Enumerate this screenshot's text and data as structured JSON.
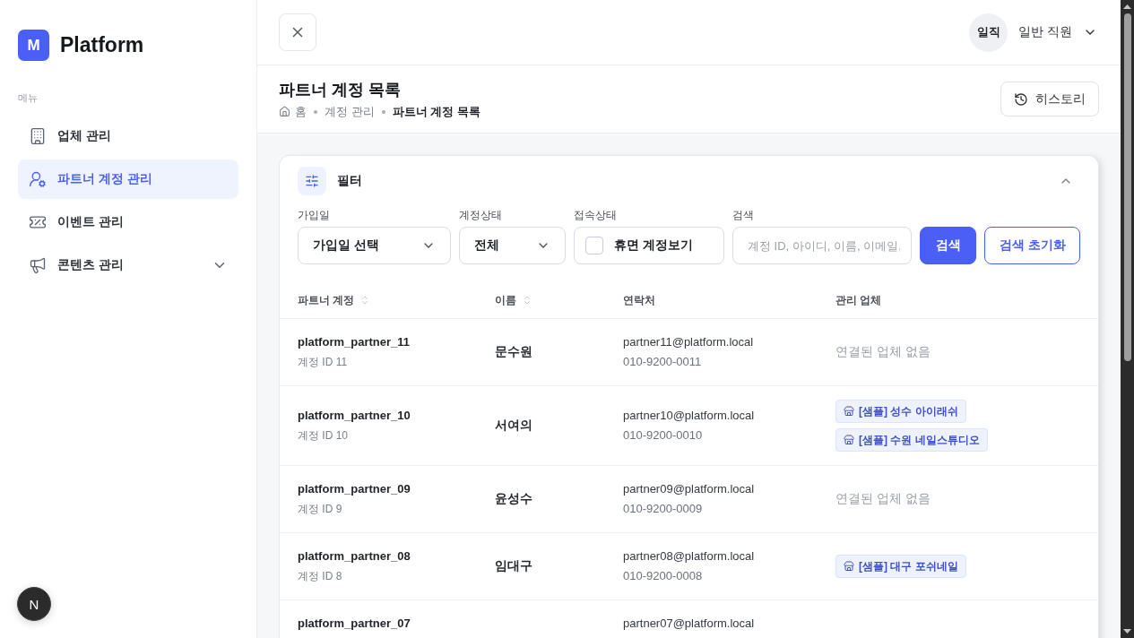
{
  "sidebar": {
    "logo": {
      "letter": "M",
      "name": "Platform"
    },
    "section_label": "메뉴",
    "items": [
      {
        "label": "업체 관리",
        "selected": false
      },
      {
        "label": "파트너 계정 관리",
        "selected": true
      },
      {
        "label": "이벤트 관리",
        "selected": false
      },
      {
        "label": "콘텐츠 관리",
        "selected": false,
        "expanded": false
      }
    ]
  },
  "dev_indicator": {
    "label": "N"
  },
  "topbar": {
    "user": {
      "avatar": "일직",
      "name": "일반 직원"
    }
  },
  "page_header": {
    "title": "파트너 계정 목록",
    "breadcrumb": [
      {
        "label": "홈",
        "current": false
      },
      {
        "label": "계정 관리",
        "current": false
      },
      {
        "label": "파트너 계정 목록",
        "current": true
      }
    ],
    "history_button": "히스토리"
  },
  "filter": {
    "title": "필터",
    "expanded": true,
    "fields": [
      {
        "kind": "select",
        "label": "가입일",
        "value": "가입일 선택"
      },
      {
        "kind": "select",
        "label": "계정상태",
        "value": "전체"
      },
      {
        "kind": "checkbox",
        "label": "접속상태",
        "text": "휴면 계정보기",
        "checked": false
      },
      {
        "kind": "search",
        "label": "검색",
        "placeholder": "계정 ID, 아이디, 이름, 이메일,"
      }
    ],
    "buttons": [
      {
        "kind": "primary",
        "label": "검색"
      },
      {
        "kind": "outline",
        "label": "검색 초기화"
      }
    ]
  },
  "table": {
    "columns": [
      {
        "label": "파트너 계정",
        "sortable": true
      },
      {
        "label": "이름",
        "sortable": true
      },
      {
        "label": "연락처",
        "sortable": false
      },
      {
        "label": "관리 업체",
        "sortable": false
      }
    ],
    "rows": [
      {
        "account": "platform_partner_11",
        "account_id": "계정 ID 11",
        "name": "문수원",
        "email": "partner11@platform.local",
        "phone": "010-9200-0011",
        "no_companies": "연결된 업체 없음"
      },
      {
        "account": "platform_partner_10",
        "account_id": "계정 ID 10",
        "name": "서여의",
        "email": "partner10@platform.local",
        "phone": "010-9200-0010",
        "companies": [
          "[샘플] 성수 아이래쉬",
          "[샘플] 수원 네일스튜디오"
        ]
      },
      {
        "account": "platform_partner_09",
        "account_id": "계정 ID 9",
        "name": "윤성수",
        "email": "partner09@platform.local",
        "phone": "010-9200-0009",
        "no_companies": "연결된 업체 없음"
      },
      {
        "account": "platform_partner_08",
        "account_id": "계정 ID 8",
        "name": "임대구",
        "email": "partner08@platform.local",
        "phone": "010-9200-0008",
        "companies": [
          "[샘플] 대구 포쉬네일"
        ]
      },
      {
        "account": "platform_partner_07",
        "email": "partner07@platform.local"
      }
    ]
  }
}
